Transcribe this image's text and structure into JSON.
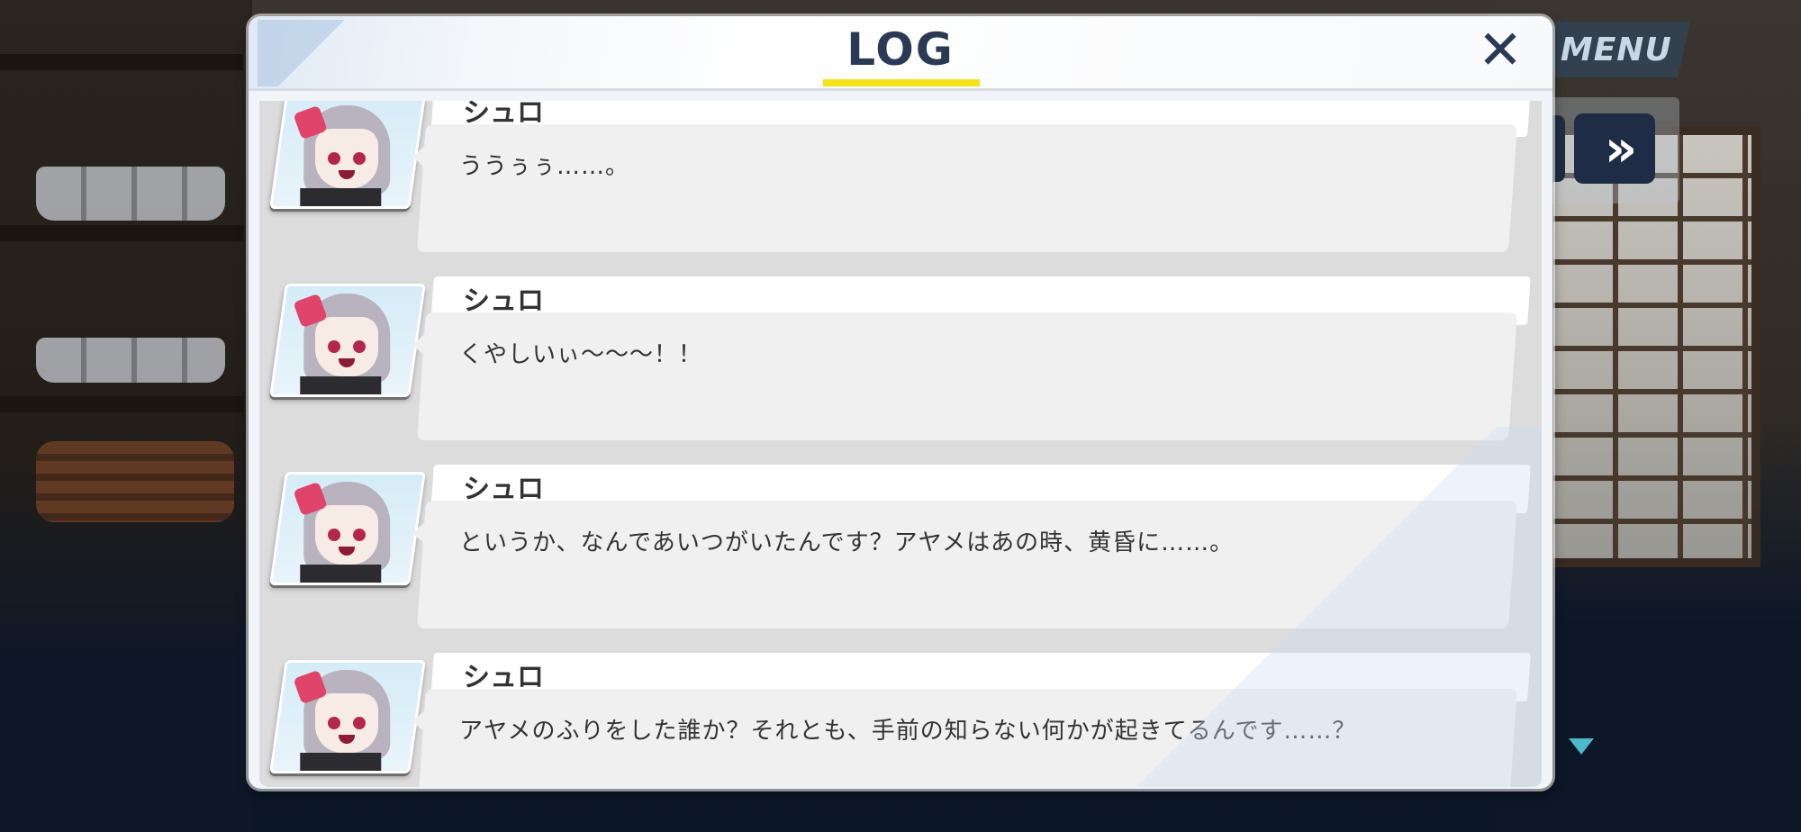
{
  "log": {
    "title": "LOG",
    "entries": [
      {
        "speaker": "シュロ",
        "text": "ううぅぅ……。"
      },
      {
        "speaker": "シュロ",
        "text": "くやしいぃ～～～！！"
      },
      {
        "speaker": "シュロ",
        "text": "というか、なんであいつがいたんです？アヤメはあの時、黄昏に……。"
      },
      {
        "speaker": "シュロ",
        "text": "アヤメのふりをした誰か？それとも、手前の知らない何かが起きてるんです……？"
      }
    ]
  },
  "hud": {
    "menu_label": "MENU",
    "fast_forward_icon": "double-chevron-right-icon",
    "close_icon": "close-x-icon",
    "next_icon": "triangle-down-icon"
  },
  "colors": {
    "title_accent": "#f5e21a",
    "title_text": "#2a3a55",
    "ribbon": "#e0446a"
  }
}
